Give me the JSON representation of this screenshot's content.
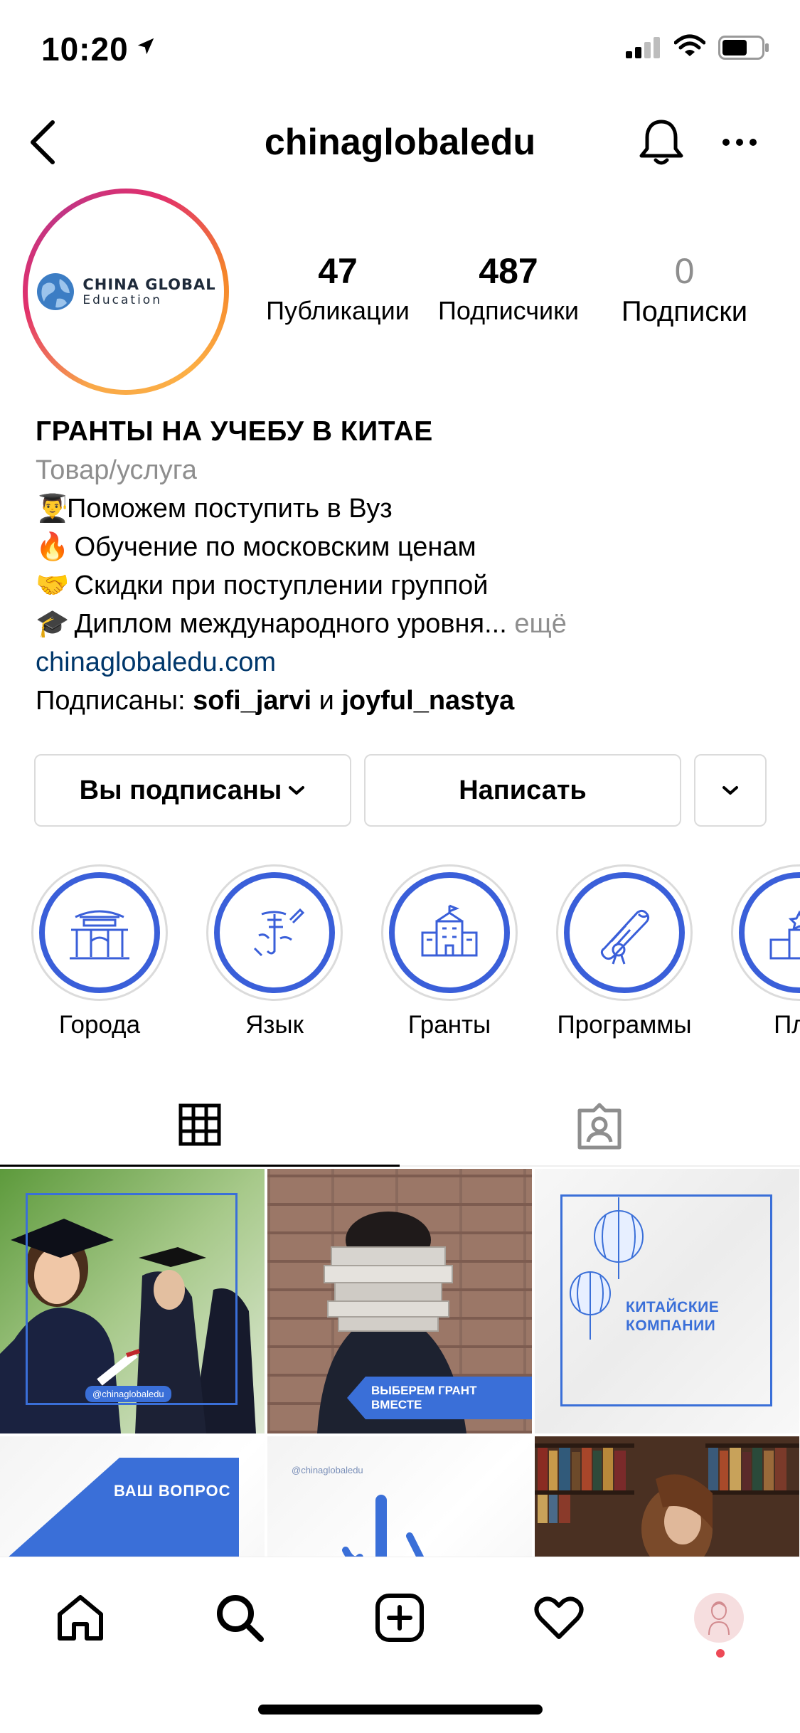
{
  "status_bar": {
    "time": "10:20"
  },
  "header": {
    "username": "chinaglobaledu"
  },
  "avatar": {
    "logo_main": "CHINA GLOBAL",
    "logo_sub": "Education"
  },
  "stats": [
    {
      "count": "47",
      "label": "Публикации"
    },
    {
      "count": "487",
      "label": "Подписчики"
    },
    {
      "count": "0",
      "label": "Подписки"
    }
  ],
  "bio": {
    "title": "ГРАНТЫ НА УЧЕБУ В КИТАЕ",
    "category": "Товар/услуга",
    "lines": [
      {
        "emoji": "👨‍🎓",
        "text": "Поможем поступить в Вуз"
      },
      {
        "emoji": "🔥",
        "text": "Обучение по московским ценам"
      },
      {
        "emoji": "🤝",
        "text": "Скидки при поступлении группой"
      },
      {
        "emoji": "🎓",
        "text": "Диплом международного уровня..."
      }
    ],
    "more": "ещё",
    "link": "chinaglobaledu.com",
    "followed_by_prefix": "Подписаны:",
    "followed_by_1": "sofi_jarvi",
    "followed_by_and": "и",
    "followed_by_2": "joyful_nastya"
  },
  "buttons": {
    "following": "Вы подписаны",
    "message": "Написать"
  },
  "highlights": [
    {
      "label": "Города",
      "icon": "pagoda-icon"
    },
    {
      "label": "Язык",
      "icon": "calligraphy-icon"
    },
    {
      "label": "Гранты",
      "icon": "university-icon"
    },
    {
      "label": "Программы",
      "icon": "diploma-icon"
    },
    {
      "label": "Плю",
      "icon": "podium-icon"
    }
  ],
  "posts": [
    {
      "caption": "@chinaglobaledu"
    },
    {
      "caption": "ВЫБЕРЕМ ГРАНТ ВМЕСТЕ"
    },
    {
      "caption": "КИТАЙСКИЕ КОМПАНИИ"
    },
    {
      "caption": "ВАШ ВОПРОС"
    },
    {
      "caption": "@chinaglobaledu"
    },
    {
      "caption": ""
    }
  ],
  "colors": {
    "accent_blue": "#3a6fd8",
    "link": "#00376b",
    "muted": "#8e8e8e",
    "notification": "#ed4956"
  }
}
